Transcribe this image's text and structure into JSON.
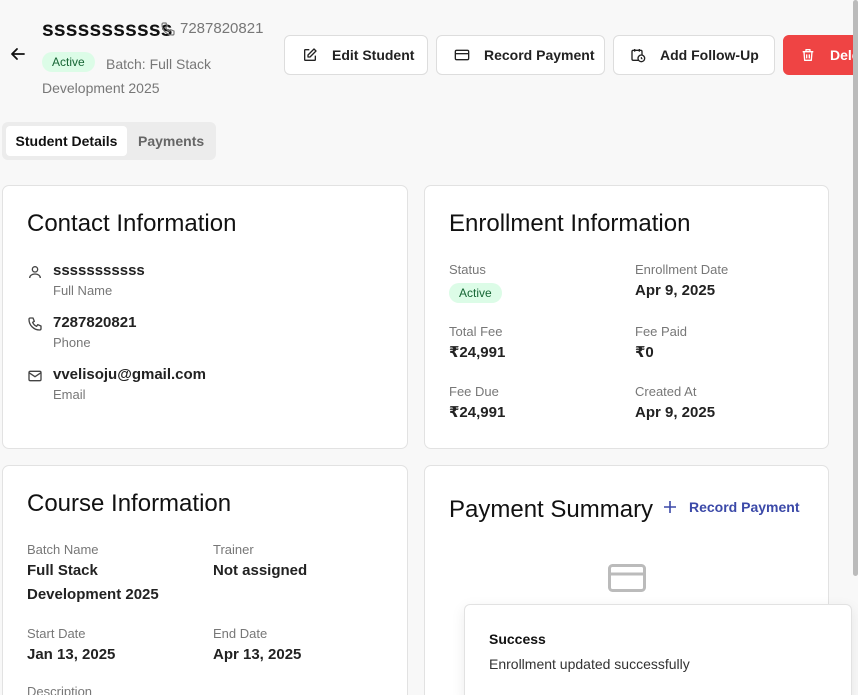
{
  "header": {
    "name": "sssssssssss",
    "phone": "7287820821",
    "status": "Active",
    "batch": "Batch: Full Stack Development 2025"
  },
  "actions": {
    "edit": "Edit Student",
    "record_payment": "Record Payment",
    "follow_up": "Add Follow-Up",
    "delete": "Delete"
  },
  "tabs": [
    "Student Details",
    "Payments"
  ],
  "contact": {
    "title": "Contact Information",
    "name_value": "sssssssssss",
    "name_label": "Full Name",
    "phone_value": "7287820821",
    "phone_label": "Phone",
    "email_value": "vvelisoju@gmail.com",
    "email_label": "Email"
  },
  "enrollment": {
    "title": "Enrollment Information",
    "status_label": "Status",
    "status_value": "Active",
    "enroll_date_label": "Enrollment Date",
    "enroll_date_value": "Apr 9, 2025",
    "total_fee_label": "Total Fee",
    "total_fee_value": "₹24,991",
    "fee_paid_label": "Fee Paid",
    "fee_paid_value": "₹0",
    "fee_due_label": "Fee Due",
    "fee_due_value": "₹24,991",
    "created_label": "Created At",
    "created_value": "Apr 9, 2025"
  },
  "course": {
    "title": "Course Information",
    "batch_label": "Batch Name",
    "batch_value": "Full Stack Development 2025",
    "trainer_label": "Trainer",
    "trainer_value": "Not assigned",
    "start_label": "Start Date",
    "start_value": "Jan 13, 2025",
    "end_label": "End Date",
    "end_value": "Apr 13, 2025",
    "description_label": "Description"
  },
  "payment_summary": {
    "title": "Payment Summary",
    "record_link": "Record Payment"
  },
  "toast": {
    "title": "Success",
    "message": "Enrollment updated successfully"
  },
  "colors": {
    "primary_link": "#3b49a8",
    "danger": "#ef4444",
    "success_bg": "#dcfce7",
    "success_text": "#166534"
  }
}
